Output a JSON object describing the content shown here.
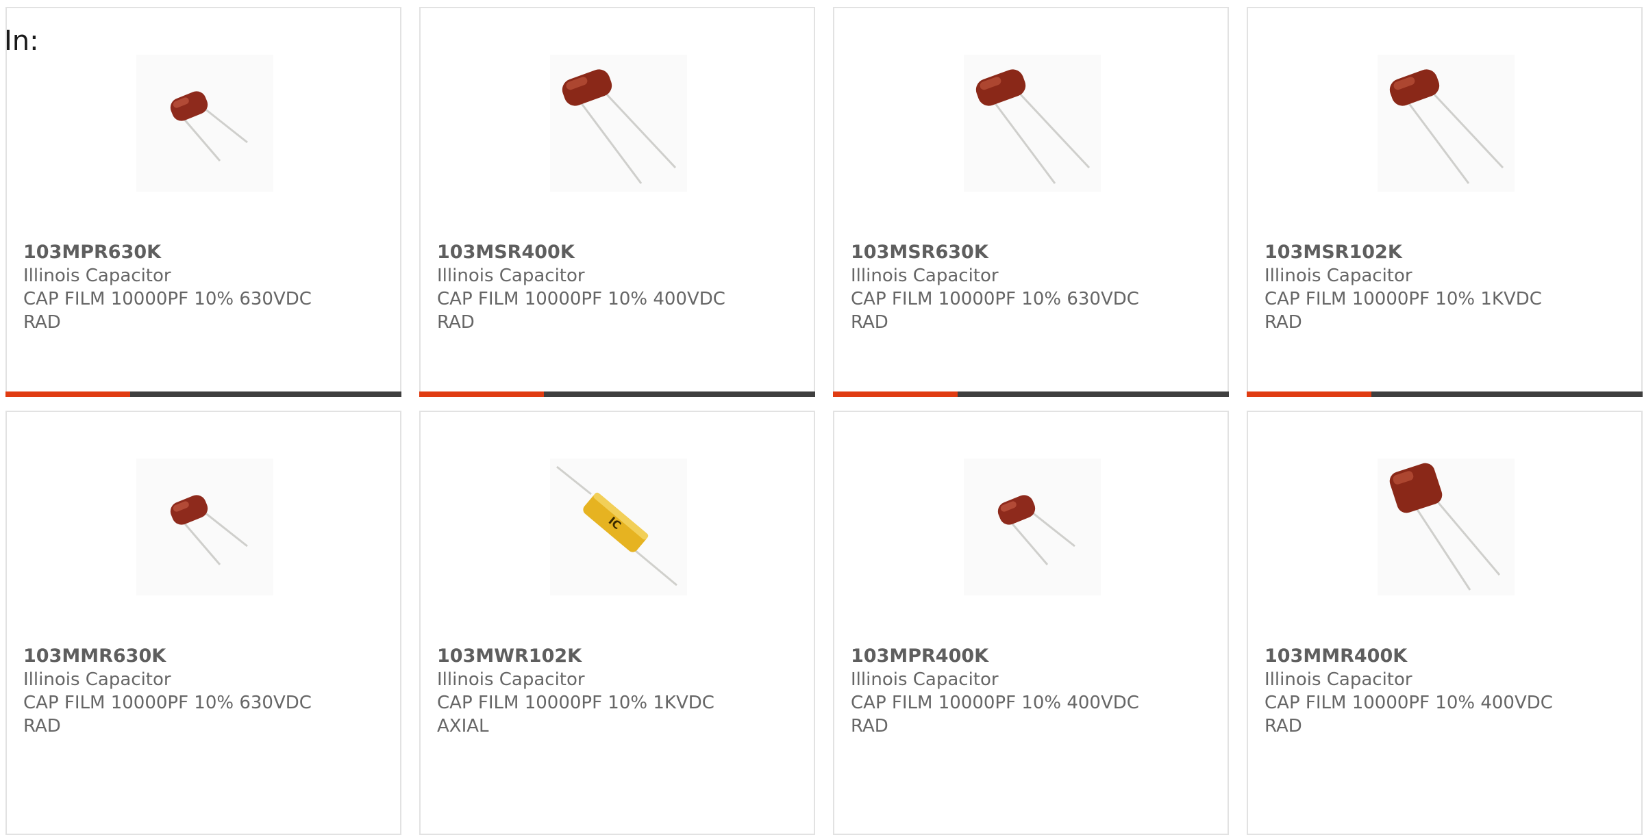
{
  "page": {
    "label": "In:"
  },
  "colors": {
    "card_border": "#e2e2e2",
    "text": "#666666",
    "accent_bar": "#e03c12",
    "dark_bar": "#3f3f3f"
  },
  "products": [
    {
      "part_number": "103MPR630K",
      "manufacturer": "Illinois Capacitor",
      "description_line1": "CAP FILM 10000PF 10% 630VDC",
      "description_line2": "RAD",
      "image_icon": "radial-capacitor-small-icon",
      "accent_progress": 0.315
    },
    {
      "part_number": "103MSR400K",
      "manufacturer": "Illinois Capacitor",
      "description_line1": "CAP FILM 10000PF 10% 400VDC",
      "description_line2": "RAD",
      "image_icon": "radial-capacitor-icon",
      "accent_progress": 0.315
    },
    {
      "part_number": "103MSR630K",
      "manufacturer": "Illinois Capacitor",
      "description_line1": "CAP FILM 10000PF 10% 630VDC",
      "description_line2": "RAD",
      "image_icon": "radial-capacitor-icon",
      "accent_progress": 0.315
    },
    {
      "part_number": "103MSR102K",
      "manufacturer": "Illinois Capacitor",
      "description_line1": "CAP FILM 10000PF 10% 1KVDC",
      "description_line2": "RAD",
      "image_icon": "radial-capacitor-icon",
      "accent_progress": 0.315
    },
    {
      "part_number": "103MMR630K",
      "manufacturer": "Illinois Capacitor",
      "description_line1": "CAP FILM 10000PF 10% 630VDC",
      "description_line2": "RAD",
      "image_icon": "radial-capacitor-small-icon"
    },
    {
      "part_number": "103MWR102K",
      "manufacturer": "Illinois Capacitor",
      "description_line1": "CAP FILM 10000PF 10% 1KVDC",
      "description_line2": "AXIAL",
      "image_icon": "axial-capacitor-icon"
    },
    {
      "part_number": "103MPR400K",
      "manufacturer": "Illinois Capacitor",
      "description_line1": "CAP FILM 10000PF 10% 400VDC",
      "description_line2": "RAD",
      "image_icon": "radial-capacitor-small-icon"
    },
    {
      "part_number": "103MMR400K",
      "manufacturer": "Illinois Capacitor",
      "description_line1": "CAP FILM 10000PF 10% 400VDC",
      "description_line2": "RAD",
      "image_icon": "radial-capacitor-large-icon"
    }
  ]
}
